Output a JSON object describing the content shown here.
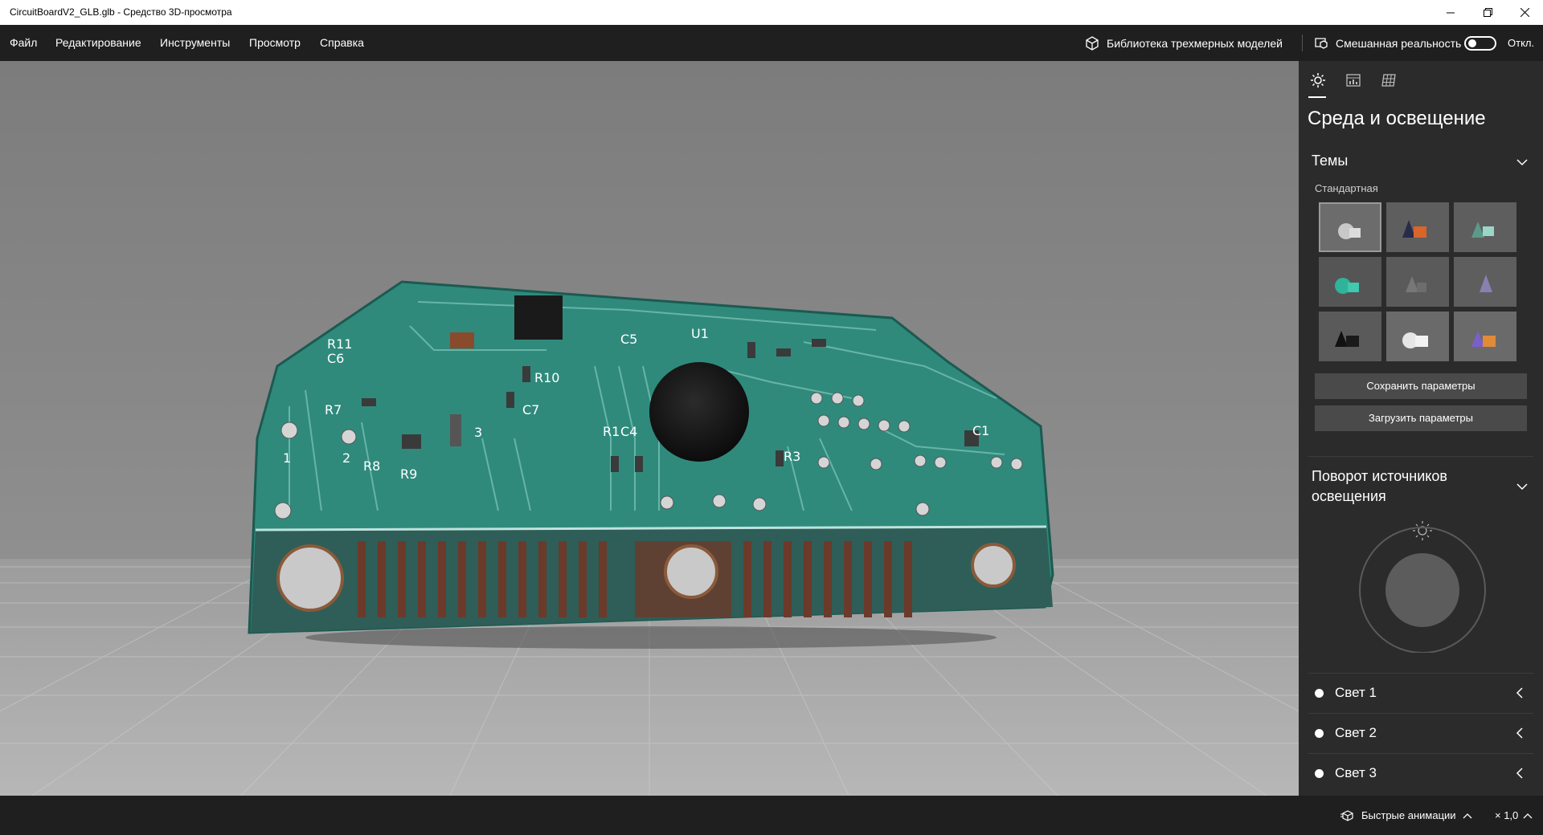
{
  "window": {
    "title": "CircuitBoardV2_GLB.glb - Средство 3D-просмотра",
    "minimize_icon": "minimize-icon",
    "maximize_icon": "restore-icon",
    "close_icon": "close-icon"
  },
  "menu": {
    "items": [
      "Файл",
      "Редактирование",
      "Инструменты",
      "Просмотр",
      "Справка"
    ],
    "library_label": "Библиотека трехмерных моделей",
    "mixed_reality_label": "Смешанная реальность",
    "toggle_state": "Откл."
  },
  "model": {
    "silkscreen": [
      "R11",
      "C6",
      "C5",
      "U1",
      "R10",
      "C7",
      "R8",
      "R9",
      "R3",
      "R1",
      "C4",
      "R7",
      "C1",
      "1",
      "2",
      "3"
    ]
  },
  "panel": {
    "tabs": [
      {
        "icon": "sun-icon"
      },
      {
        "icon": "stats-icon"
      },
      {
        "icon": "grid-icon"
      }
    ],
    "title": "Среда и освещение",
    "themes_header": "Темы",
    "themes_sub": "Стандартная",
    "theme_count": 9,
    "save_button": "Сохранить параметры",
    "load_button": "Загрузить параметры",
    "rotation_header": "Поворот источников освещения",
    "lights": [
      "Свет 1",
      "Свет 2",
      "Свет 3"
    ]
  },
  "status": {
    "animations_label": "Быстрые анимации",
    "speed": "× 1,0"
  },
  "colors": {
    "chrome": "#1f1f1f",
    "panel": "#2b2b2b",
    "pcb": "#2f8a7c",
    "button": "#4a4a4a"
  }
}
